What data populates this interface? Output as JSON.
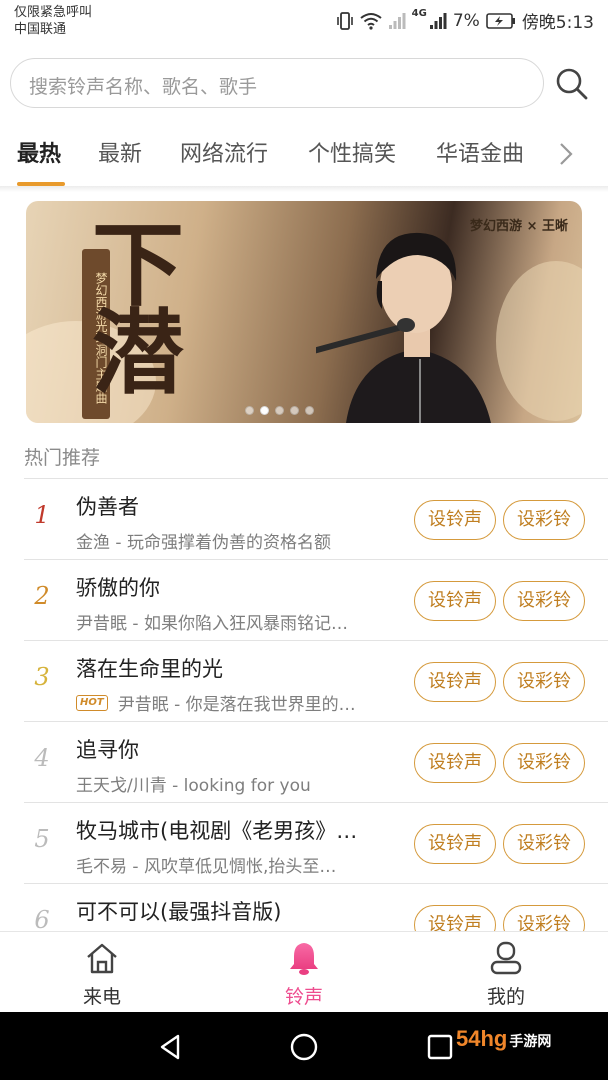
{
  "status_bar": {
    "carrier_line1": "仅限紧急呼叫",
    "carrier_line2": "中国联通",
    "battery": "7%",
    "time": "傍晚5:13",
    "network": "4G"
  },
  "search": {
    "placeholder": "搜索铃声名称、歌名、歌手",
    "icon": "search-icon"
  },
  "tabs": [
    {
      "label": "最热",
      "active": true
    },
    {
      "label": "最新"
    },
    {
      "label": "网络流行"
    },
    {
      "label": "个性搞笑"
    },
    {
      "label": "华语金曲"
    }
  ],
  "banner": {
    "title": "下潜",
    "vertical_caption": "梦幻西游光环洞门主题曲",
    "logo": "梦幻西游 × 王晰",
    "slides": 5,
    "active_slide": 2
  },
  "section": {
    "title": "热门推荐"
  },
  "songs": [
    {
      "rank": "1",
      "title": "伪善者",
      "subtitle": "金渔 - 玩命强撑着伪善的资格名额",
      "hot": false
    },
    {
      "rank": "2",
      "title": "骄傲的你",
      "subtitle": "尹昔眠 - 如果你陷入狂风暴雨铭记…",
      "hot": false
    },
    {
      "rank": "3",
      "title": "落在生命里的光",
      "subtitle": "尹昔眠 - 你是落在我世界里的…",
      "hot": true,
      "hot_label": "HOT"
    },
    {
      "rank": "4",
      "title": "追寻你",
      "subtitle": "王天戈/川青 - looking for you",
      "hot": false
    },
    {
      "rank": "5",
      "title": "牧马城市(电视剧《老男孩》…",
      "subtitle": "毛不易 - 风吹草低见惆怅,抬头至…",
      "hot": false
    },
    {
      "rank": "6",
      "title": "可不可以(最强抖音版)",
      "subtitle": "",
      "hot": false
    }
  ],
  "buttons": {
    "ringtone": "设铃声",
    "color_ring": "设彩铃"
  },
  "bottom_nav": [
    {
      "label": "来电",
      "icon": "home-icon"
    },
    {
      "label": "铃声",
      "icon": "bell-icon",
      "active": true
    },
    {
      "label": "我的",
      "icon": "user-icon"
    }
  ],
  "watermark": {
    "text": "54hg",
    "suffix": "手游网"
  },
  "colors": {
    "accent": "#e89a2c",
    "button": "#d59a3c",
    "active_nav": "#ee4d8f",
    "rank1": "#c0392b",
    "rank2": "#d08b2a",
    "rank3": "#d6b33b"
  }
}
